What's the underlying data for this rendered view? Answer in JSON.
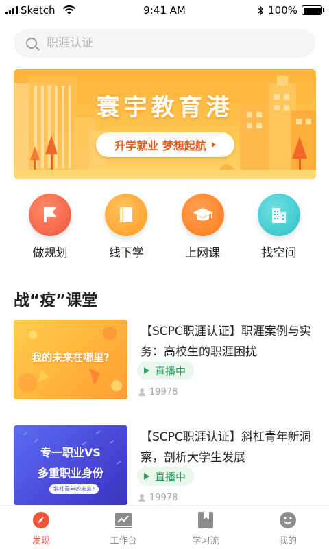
{
  "status_bar": {
    "carrier": "Sketch",
    "time": "9:41 AM",
    "battery": "100%"
  },
  "search": {
    "placeholder": "职涯认证"
  },
  "banner": {
    "title": "寰宇教育港",
    "button_label": "升学就业 梦想起航"
  },
  "quick_nav": [
    {
      "label": "做规划",
      "icon": "flag-icon",
      "color": "#f0553c"
    },
    {
      "label": "线下学",
      "icon": "book-icon",
      "color": "#ff9a1f"
    },
    {
      "label": "上网课",
      "icon": "graduation-cap-icon",
      "color": "#ff7a1a"
    },
    {
      "label": "找空间",
      "icon": "building-icon",
      "color": "#29c2c8"
    }
  ],
  "section": {
    "title": "战“疫”课堂"
  },
  "courses": [
    {
      "title": "【SCPC职涯认证】职涯案例与实务：高校生的职涯困扰",
      "badge": "直播中",
      "viewers": "19978",
      "thumb_text": "我的未来在哪里?"
    },
    {
      "title": "【SCPC职涯认证】斜杠青年新洞察，剖析大学生发展",
      "badge": "直播中",
      "viewers": "19978",
      "thumb_line1": "专一职业VS",
      "thumb_line2": "多重职业身份",
      "thumb_caption": "斜杠青年的未来?"
    }
  ],
  "tabs": [
    {
      "label": "发现",
      "icon": "compass-icon",
      "active": true
    },
    {
      "label": "工作台",
      "icon": "chart-icon",
      "active": false
    },
    {
      "label": "学习流",
      "icon": "bookmark-icon",
      "active": false
    },
    {
      "label": "我的",
      "icon": "smiley-icon",
      "active": false
    }
  ],
  "colors": {
    "accent": "#f0553c",
    "live_green": "#2aa15c",
    "banner_orange": "#ffb23a"
  }
}
